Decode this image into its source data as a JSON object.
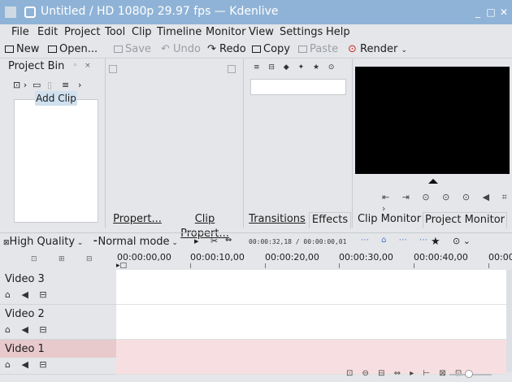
{
  "window": {
    "title": "Untitled / HD 1080p 29.97 fps — Kdenlive",
    "accent": "#8fb3d6"
  },
  "menu": [
    "File",
    "Edit",
    "Project",
    "Tool",
    "Clip",
    "Timeline",
    "Monitor",
    "View",
    "Settings",
    "Help"
  ],
  "toolbar": {
    "new": "New",
    "open": "Open...",
    "save": "Save",
    "undo": "Undo",
    "redo": "Redo",
    "copy": "Copy",
    "paste": "Paste",
    "render": "Render"
  },
  "project_bin": {
    "title": "Project Bin",
    "tooltip": "Add Clip"
  },
  "tabs": {
    "properties": "Propert...",
    "clip_properties": "Clip Propert...",
    "transitions": "Transitions",
    "effects": "Effects",
    "clip_monitor": "Clip Monitor",
    "project_monitor": "Project Monitor"
  },
  "timeline_toolbar": {
    "quality": "High Quality",
    "mode": "Normal mode",
    "timecode": "00:00:32,18 / 00:00:00,01"
  },
  "ruler": [
    "00:00:00,00",
    "00:00:10,00",
    "00:00:20,00",
    "00:00:30,00",
    "00:00:40,00",
    "00:00"
  ],
  "tracks": [
    {
      "name": "Video 3",
      "selected": false
    },
    {
      "name": "Video 2",
      "selected": false
    },
    {
      "name": "Video 1",
      "selected": true
    }
  ]
}
